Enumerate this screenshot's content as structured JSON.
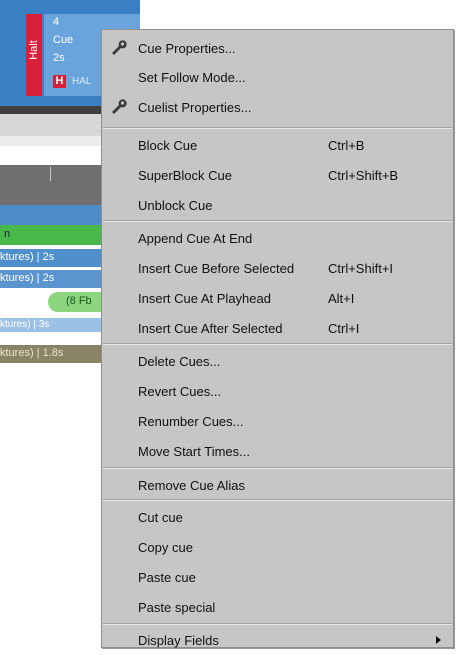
{
  "background": {
    "cue": {
      "halt_label": "Halt",
      "number": "4",
      "name": "Cue",
      "time": "2s",
      "badge": "H",
      "badge_text": "HAL"
    },
    "strips": {
      "green_text": "n",
      "fixture_row_1": "ktures) | 2s",
      "fixture_row_2": "ktures) | 2s",
      "pill_text": "(8 Fb",
      "fixture_row_3": "ktures) | 3s",
      "fixture_row_4": "ktures) | 1.8s"
    }
  },
  "menu": {
    "items": [
      {
        "label": "Cue Properties...",
        "shortcut": "",
        "icon": "wrench-icon"
      },
      {
        "label": "Set Follow Mode...",
        "shortcut": ""
      },
      {
        "label": "Cuelist Properties...",
        "shortcut": "",
        "icon": "wrench-icon"
      },
      {
        "label": "Block Cue",
        "shortcut": "Ctrl+B"
      },
      {
        "label": "SuperBlock Cue",
        "shortcut": "Ctrl+Shift+B"
      },
      {
        "label": "Unblock Cue",
        "shortcut": ""
      },
      {
        "label": "Append Cue At End",
        "shortcut": ""
      },
      {
        "label": "Insert Cue Before Selected",
        "shortcut": "Ctrl+Shift+I"
      },
      {
        "label": "Insert Cue At Playhead",
        "shortcut": "Alt+I"
      },
      {
        "label": "Insert Cue After Selected",
        "shortcut": "Ctrl+I"
      },
      {
        "label": "Delete Cues...",
        "shortcut": ""
      },
      {
        "label": "Revert Cues...",
        "shortcut": ""
      },
      {
        "label": "Renumber Cues...",
        "shortcut": ""
      },
      {
        "label": "Move Start Times...",
        "shortcut": ""
      },
      {
        "label": "Remove Cue Alias",
        "shortcut": ""
      },
      {
        "label": "Cut cue",
        "shortcut": ""
      },
      {
        "label": "Copy cue",
        "shortcut": ""
      },
      {
        "label": "Paste cue",
        "shortcut": ""
      },
      {
        "label": "Paste special",
        "shortcut": ""
      },
      {
        "label": "Display Fields",
        "shortcut": "",
        "submenu": true
      }
    ]
  }
}
